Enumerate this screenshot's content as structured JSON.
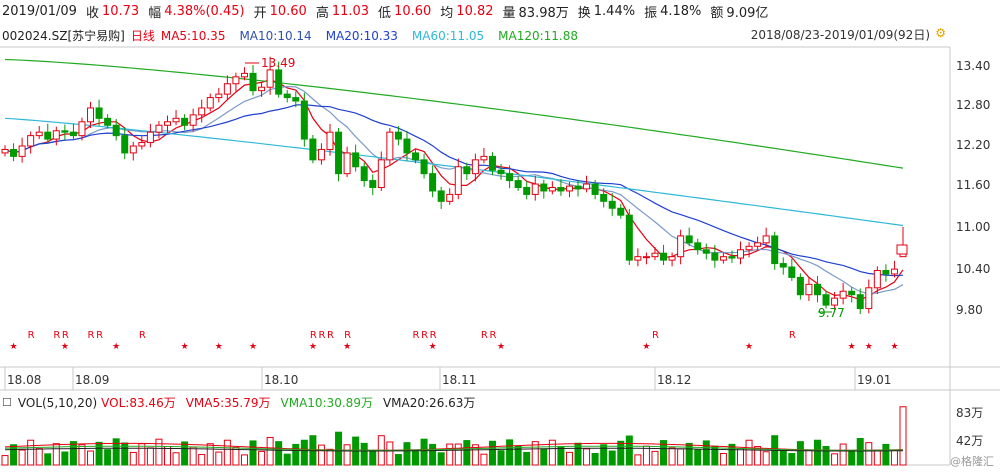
{
  "stats": {
    "date": "2019/01/09",
    "close_label": "收",
    "close": "10.73",
    "amp_label": "幅",
    "amp": "4.38%(0.45)",
    "open_label": "开",
    "open": "10.60",
    "high_label": "高",
    "high": "11.03",
    "low_label": "低",
    "low": "10.60",
    "avg_label": "均",
    "avg": "10.82",
    "vol_label": "量",
    "vol": "83.98万",
    "turnover_label": "换",
    "turnover": "1.44%",
    "swing_label": "振",
    "swing": "4.18%",
    "amount_label": "额",
    "amount": "9.09亿"
  },
  "ma_bar": {
    "code": "002024.SZ",
    "name": "[苏宁易购]",
    "period": "日线",
    "ma5": "MA5:10.35",
    "ma10": "MA10:10.14",
    "ma20": "MA20:10.33",
    "ma60": "MA60:11.05",
    "ma120": "MA120:11.88",
    "range": "2018/08/23-2019/01/09(92日)"
  },
  "price_axis": [
    "13.40",
    "12.80",
    "12.20",
    "11.60",
    "11.00",
    "10.40",
    "9.80"
  ],
  "annotations": {
    "high": "13.49",
    "low": "9.77"
  },
  "r_marker": "R",
  "star_marker": "★",
  "x_labels": [
    "18.08",
    "18.09",
    "18.10",
    "18.11",
    "18.12",
    "19.01"
  ],
  "volume_bar": {
    "label": "VOL(5,10,20)",
    "vol": "VOL:83.46万",
    "vma5": "VMA5:35.79万",
    "vma10": "VMA10:30.89万",
    "vma20": "VMA20:26.63万"
  },
  "volume_axis": [
    "83万",
    "42万"
  ],
  "watermark": "@格隆汇",
  "colors": {
    "up": "#e60012",
    "down": "#009900",
    "ma5": "#e60012",
    "ma10": "#7a9ac8",
    "ma20": "#2040d0",
    "ma60": "#30b8d8",
    "ma120": "#22aa22"
  },
  "chart_data": [
    {
      "type": "candlestick",
      "title": "002024.SZ [苏宁易购] 日线",
      "x_range": [
        "2018/08/23",
        "2019/01/09"
      ],
      "ylim": [
        9.6,
        13.6
      ],
      "y_ticks": [
        13.4,
        12.8,
        12.2,
        11.6,
        11.0,
        10.4,
        9.8
      ],
      "last": {
        "date": "2019/01/09",
        "open": 10.6,
        "high": 11.03,
        "low": 10.6,
        "close": 10.73
      },
      "ma_last": {
        "MA5": 10.35,
        "MA10": 10.14,
        "MA20": 10.33,
        "MA60": 11.05,
        "MA120": 11.88
      },
      "extremes": {
        "high": 13.49,
        "low": 9.77
      },
      "closes": [
        12.15,
        12.05,
        12.2,
        12.35,
        12.4,
        12.3,
        12.42,
        12.4,
        12.35,
        12.55,
        12.75,
        12.6,
        12.5,
        12.35,
        12.1,
        12.2,
        12.25,
        12.4,
        12.5,
        12.55,
        12.6,
        12.5,
        12.65,
        12.75,
        12.9,
        12.95,
        13.1,
        13.2,
        13.25,
        13.0,
        13.05,
        13.3,
        12.95,
        12.9,
        12.85,
        12.3,
        12.0,
        12.15,
        12.4,
        11.8,
        12.1,
        11.9,
        11.7,
        11.6,
        12.0,
        12.4,
        12.3,
        12.1,
        12.0,
        11.8,
        11.55,
        11.4,
        11.5,
        11.9,
        11.8,
        12.0,
        12.05,
        11.85,
        11.8,
        11.7,
        11.6,
        11.5,
        11.65,
        11.55,
        11.6,
        11.55,
        11.62,
        11.58,
        11.65,
        11.5,
        11.4,
        11.3,
        11.2,
        10.55,
        10.6,
        10.6,
        10.65,
        10.55,
        10.6,
        10.9,
        10.8,
        10.7,
        10.65,
        10.55,
        10.6,
        10.58,
        10.7,
        10.75,
        10.8,
        10.9,
        10.5,
        10.45,
        10.3,
        10.05,
        10.2,
        10.05,
        9.9,
        10.0,
        10.1,
        10.05,
        9.85,
        10.15,
        10.4,
        10.35,
        10.42,
        10.73
      ]
    },
    {
      "type": "bar",
      "title": "VOL(5,10,20)",
      "ylim": [
        0,
        86
      ],
      "y_ticks": [
        83,
        42
      ],
      "series_last": {
        "VOL": 83.46,
        "VMA5": 35.79,
        "VMA10": 30.89,
        "VMA20": 26.63
      },
      "unit": "万"
    }
  ]
}
